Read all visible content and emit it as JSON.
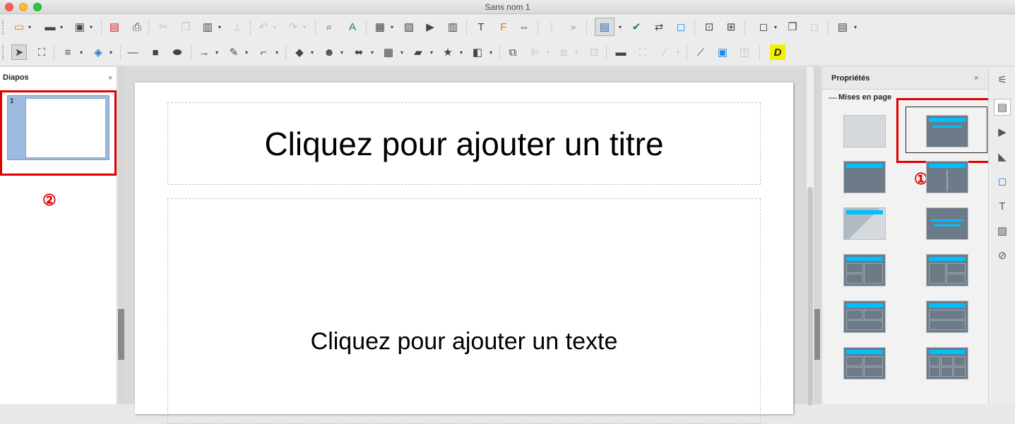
{
  "window": {
    "title": "Sans nom 1"
  },
  "slides_panel": {
    "title": "Diapos",
    "close": "×",
    "slide_number": "1"
  },
  "canvas": {
    "title_placeholder": "Cliquez pour ajouter un titre",
    "body_placeholder": "Cliquez pour ajouter un texte"
  },
  "properties": {
    "title": "Propriétés",
    "close": "×",
    "section": "Mises en page",
    "section_toggle": "—"
  },
  "annotations": {
    "marker1": "①",
    "marker2": "②"
  },
  "colors": {
    "accent_blue": "#00bfff",
    "highlight_red": "#e00000",
    "fontwork_yellow": "#f2ef00"
  }
}
